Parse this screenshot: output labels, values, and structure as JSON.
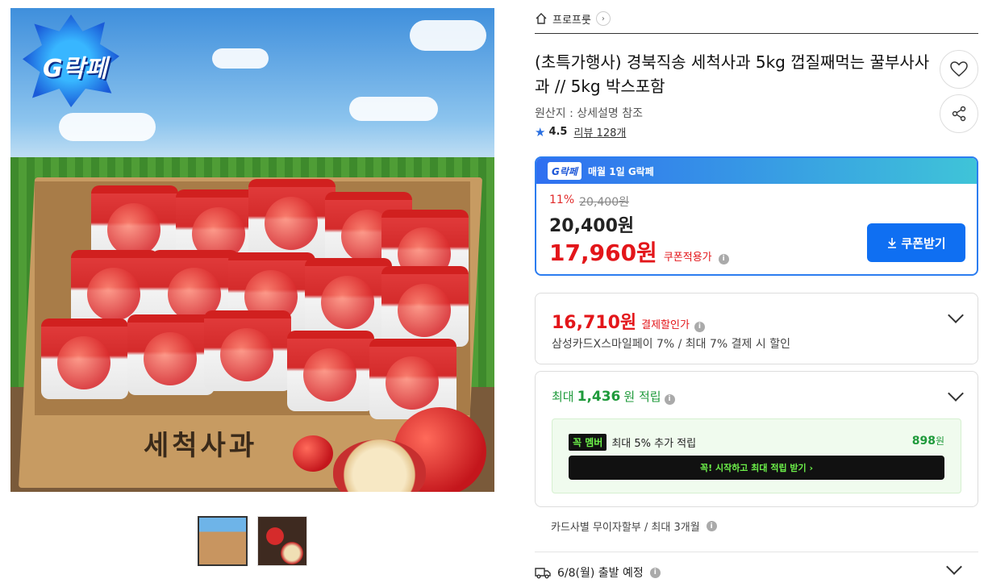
{
  "image": {
    "logo_text": "G락페",
    "box_text": "세척사과"
  },
  "breadcrumb": {
    "label": "프로프룻"
  },
  "product": {
    "title": "(초특가행사) 경북직송 세척사과 5kg 껍질째먹는 꿀부사사과 // 5kg 박스포함",
    "origin": "원산지 : 상세설명 참조",
    "rating": "4.5",
    "review_label": "리뷰",
    "review_count": "128개"
  },
  "gfair": {
    "logo": "G락페",
    "banner": "매월 1일 G락페",
    "discount_rate": "11%",
    "original_price": "20,400원",
    "price": "20,400원",
    "coupon_price": "17,960원",
    "coupon_label": "쿠폰적용가",
    "coupon_button": "쿠폰받기"
  },
  "payment": {
    "price": "16,710원",
    "label": "결제할인가",
    "detail": "삼성카드X스마일페이 7% / 최대 7% 결제 시 할인"
  },
  "points": {
    "prefix": "최대",
    "amount": "1,436",
    "suffix": "원 적립",
    "member_badge": "꼭 멤버",
    "member_text": "최대 5% 추가 적립",
    "member_points": "898",
    "member_points_unit": "원",
    "member_button": "꼭! 시작하고 최대 적립 받기 ›"
  },
  "installment": "카드사별 무이자할부 / 최대 3개월",
  "shipping": "6/8(월) 출발 예정",
  "colors": {
    "accent_blue": "#0f6ff2",
    "price_red": "#e3161a",
    "points_green": "#1f9a3b"
  }
}
